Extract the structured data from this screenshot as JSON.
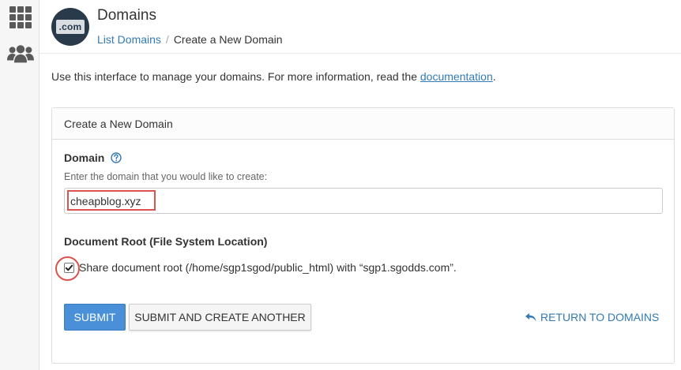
{
  "sidebar": {
    "icons": [
      "grid-icon",
      "users-icon"
    ]
  },
  "header": {
    "logo_text": ".com",
    "title": "Domains",
    "breadcrumb": {
      "parent": "List Domains",
      "separator": "/",
      "current": "Create a New Domain"
    }
  },
  "intro": {
    "text": "Use this interface to manage your domains. For more information, read the ",
    "link": "documentation",
    "suffix": "."
  },
  "panel": {
    "heading": "Create a New Domain",
    "domain": {
      "label": "Domain",
      "hint": "Enter the domain that you would like to create:",
      "value": "cheapblog.xyz"
    },
    "docroot": {
      "label": "Document Root (File System Location)",
      "checkbox_label": "Share document root (/home/sgp1sgod/public_html) with “sgp1.sgodds.com”.",
      "checked": true
    },
    "buttons": {
      "submit": "SUBMIT",
      "submit_another": "SUBMIT AND CREATE ANOTHER",
      "return": "RETURN TO DOMAINS"
    }
  },
  "colors": {
    "link": "#337ab7",
    "primary": "#4a90d9",
    "highlight": "#d9534f",
    "logo_bg": "#293a4a"
  }
}
